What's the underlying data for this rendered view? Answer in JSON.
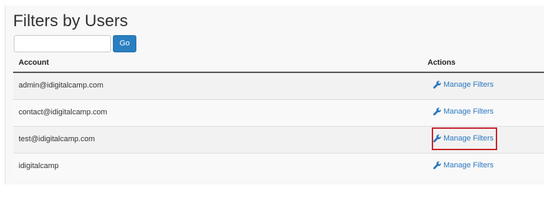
{
  "page": {
    "title": "Filters by Users"
  },
  "search": {
    "value": "",
    "placeholder": "",
    "button_label": "Go"
  },
  "table": {
    "columns": [
      "Account",
      "Actions"
    ],
    "rows": [
      {
        "account": "admin@idigitalcamp.com",
        "action_label": "Manage Filters",
        "highlighted": false
      },
      {
        "account": "contact@idigitalcamp.com",
        "action_label": "Manage Filters",
        "highlighted": false
      },
      {
        "account": "test@idigitalcamp.com",
        "action_label": "Manage Filters",
        "highlighted": true
      },
      {
        "account": "idigitalcamp",
        "action_label": "Manage Filters",
        "highlighted": false
      }
    ]
  },
  "icons": {
    "action_icon": "wrench-icon"
  },
  "colors": {
    "primary_button": "#2a7fc0",
    "link": "#2a78bd",
    "highlight_border": "#c8232c",
    "header_rule": "#555555"
  }
}
